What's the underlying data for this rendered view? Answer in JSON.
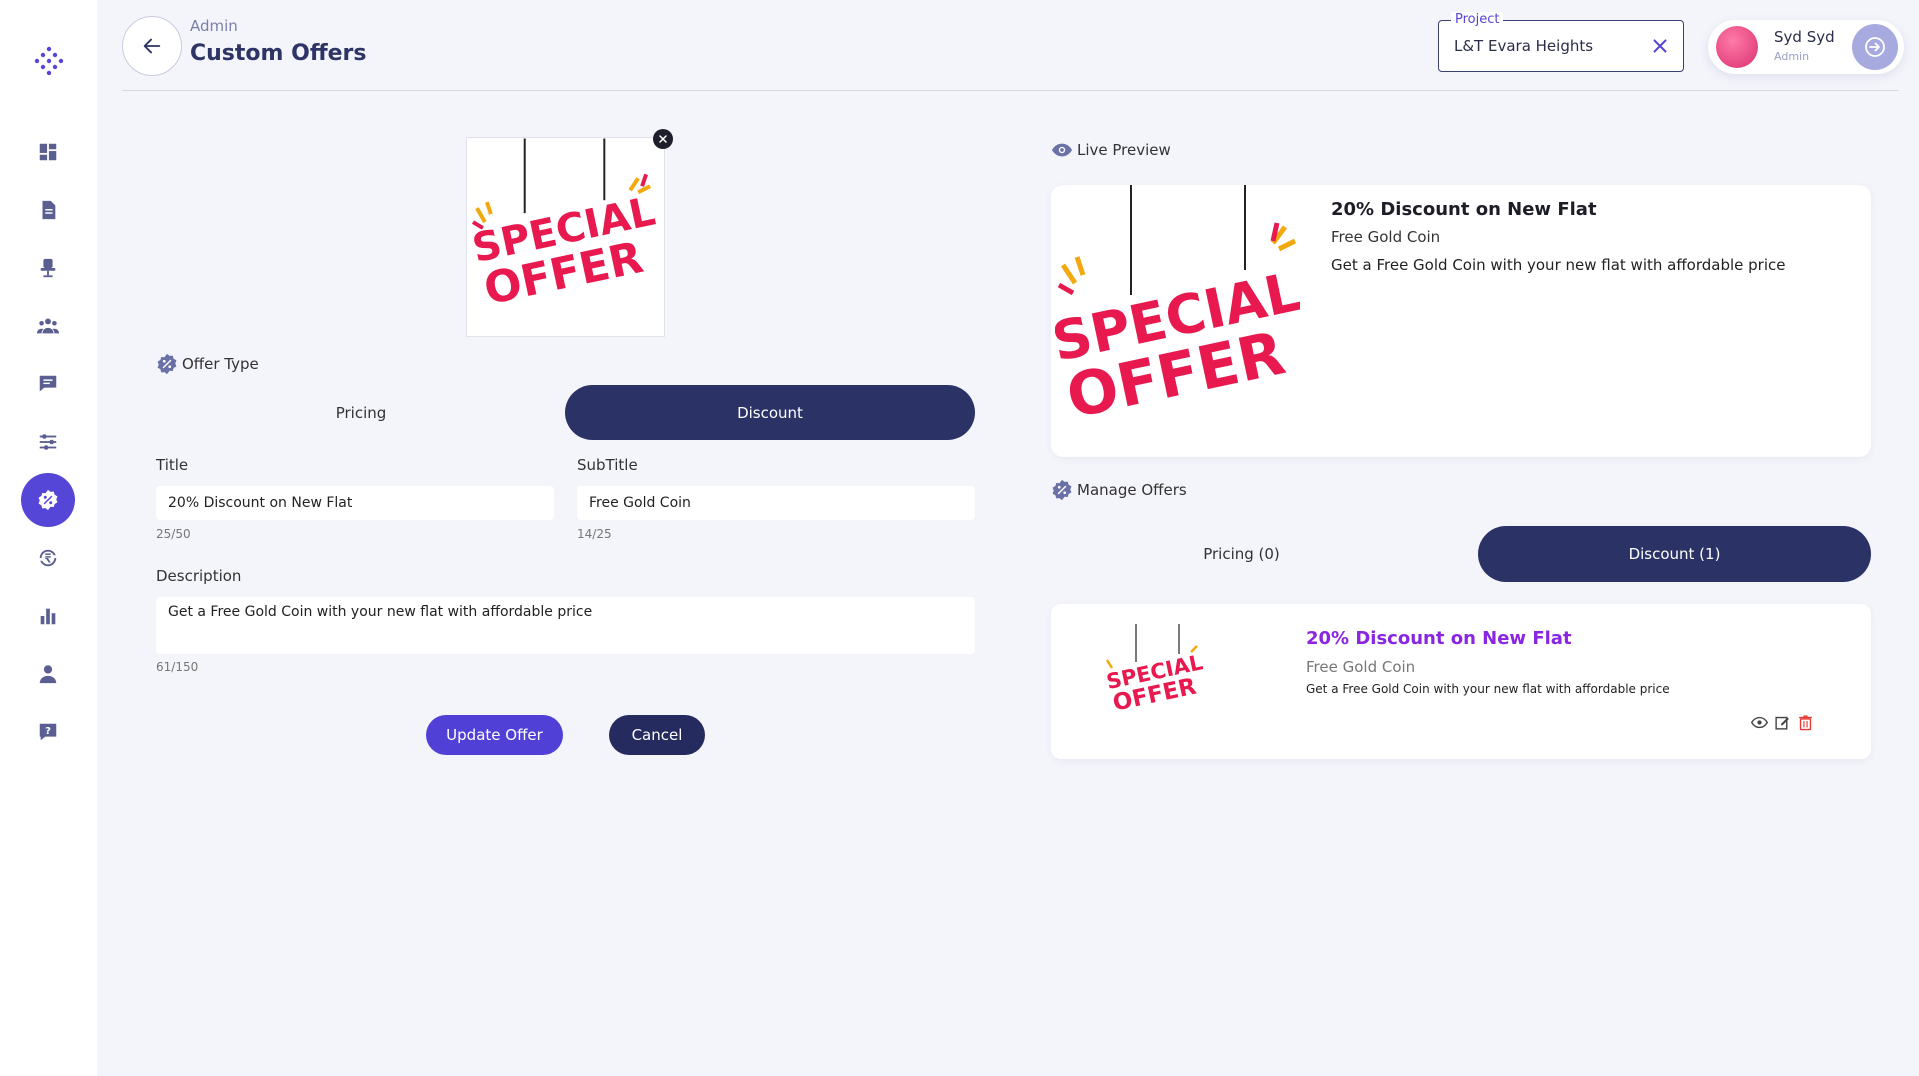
{
  "header": {
    "breadcrumb": "Admin",
    "title": "Custom Offers",
    "project_label": "Project",
    "project_value": "L&T Evara Heights"
  },
  "user": {
    "name": "Syd Syd",
    "role": "Admin"
  },
  "sidebar": {
    "items": [
      {
        "icon": "dashboard-icon"
      },
      {
        "icon": "document-icon"
      },
      {
        "icon": "chair-icon"
      },
      {
        "icon": "group-icon"
      },
      {
        "icon": "chat-icon"
      },
      {
        "icon": "sliders-icon"
      },
      {
        "icon": "discount-icon",
        "active": true
      },
      {
        "icon": "refresh-rupee-icon"
      },
      {
        "icon": "bar-chart-icon"
      },
      {
        "icon": "user-icon"
      },
      {
        "icon": "help-icon"
      }
    ]
  },
  "form": {
    "image_text": [
      "SPECIAL",
      "OFFER"
    ],
    "offer_type_label": "Offer Type",
    "offer_types": [
      "Pricing",
      "Discount"
    ],
    "selected_type": "Discount",
    "title_label": "Title",
    "title_value": "20% Discount on New Flat",
    "title_count": "25/50",
    "subtitle_label": "SubTitle",
    "subtitle_value": "Free Gold Coin",
    "subtitle_count": "14/25",
    "description_label": "Description",
    "description_value": "Get a Free Gold Coin with your new flat with affordable price",
    "description_count": "61/150",
    "update_label": "Update Offer",
    "cancel_label": "Cancel"
  },
  "preview": {
    "label": "Live Preview",
    "title": "20% Discount on New Flat",
    "subtitle": "Free Gold Coin",
    "description": "Get a Free Gold Coin with your new flat with affordable price"
  },
  "manage": {
    "label": "Manage Offers",
    "tabs": [
      "Pricing (0)",
      "Discount (1)"
    ],
    "offers": [
      {
        "title": "20% Discount on New Flat",
        "subtitle": "Free Gold Coin",
        "description": "Get a Free Gold Coin with your new flat with affordable price"
      }
    ]
  },
  "colors": {
    "accent": "#5546d8",
    "navy": "#2b3266",
    "offer_title": "#8a26e2",
    "special_red": "#e8194f"
  }
}
